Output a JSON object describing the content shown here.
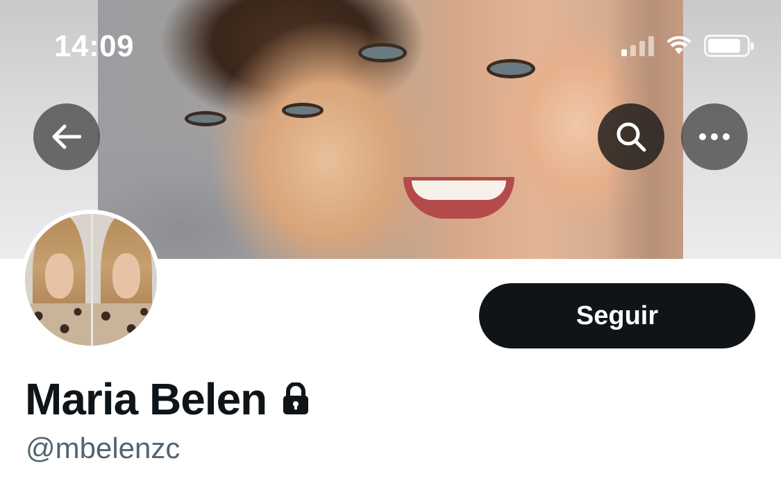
{
  "status_bar": {
    "time": "14:09",
    "signal_icon": "signal-icon",
    "wifi_icon": "wifi-icon",
    "battery_icon": "battery-icon"
  },
  "nav": {
    "back_icon": "arrow-left-icon",
    "search_icon": "search-icon",
    "more_icon": "more-horizontal-icon"
  },
  "profile": {
    "display_name": "Maria Belen",
    "protected_icon": "lock-icon",
    "handle": "@mbelenzc",
    "follow_label": "Seguir"
  },
  "colors": {
    "follow_bg": "#0f1419",
    "follow_text": "#ffffff",
    "name_text": "#0f1419",
    "handle_text": "#536471"
  }
}
